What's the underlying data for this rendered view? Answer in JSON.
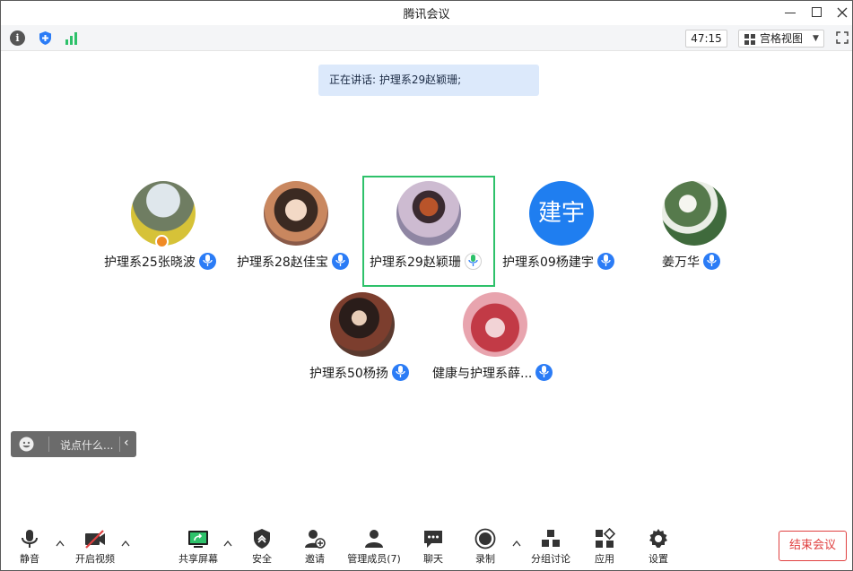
{
  "window": {
    "title": "腾讯会议"
  },
  "toolbar": {
    "timer": "47:15",
    "view_label": "宫格视图"
  },
  "speaking_banner": "正在讲话: 护理系29赵颖珊;",
  "participants": [
    {
      "name": "护理系25张晓波",
      "mic": "blue",
      "host": true
    },
    {
      "name": "护理系28赵佳宝",
      "mic": "blue",
      "host": false
    },
    {
      "name": "护理系29赵颖珊",
      "mic": "green",
      "host": false,
      "active": true
    },
    {
      "name": "护理系09杨建宇",
      "mic": "blue",
      "host": false,
      "avatar_text": "建宇"
    },
    {
      "name": "姜万华",
      "mic": "blue",
      "host": false
    },
    {
      "name": "护理系50杨扬",
      "mic": "blue",
      "host": false
    },
    {
      "name": "健康与护理系薛...",
      "mic": "blue",
      "host": false
    }
  ],
  "chat": {
    "placeholder": "说点什么..."
  },
  "bottom_bar": {
    "mute": "静音",
    "video": "开启视频",
    "share": "共享屏幕",
    "security": "安全",
    "invite": "邀请",
    "members": "管理成员(7)",
    "chat": "聊天",
    "record": "录制",
    "breakout": "分组讨论",
    "apps": "应用",
    "settings": "设置",
    "end": "结束会议"
  },
  "colors": {
    "accent_blue": "#2b7cf6",
    "active_green": "#2ec16a",
    "end_red": "#e04040",
    "banner_bg": "#dce9fb"
  }
}
